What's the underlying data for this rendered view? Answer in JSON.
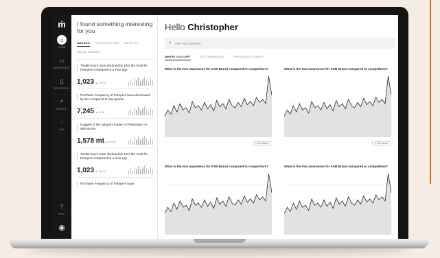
{
  "colors": {
    "accent": "#d9691f",
    "sidebar": "#161616",
    "chart_fill": "#e2e2e2",
    "chart_line": "#2a2a2a"
  },
  "sidebar": {
    "logo": "ṁ",
    "items": [
      {
        "icon": "home-icon",
        "glyph": "⌂",
        "label": "HOME",
        "active": true
      },
      {
        "icon": "folder-icon",
        "glyph": "▭",
        "label": "WORKSPACE",
        "active": false
      },
      {
        "icon": "document-icon",
        "glyph": "▯",
        "label": "RESOURCES",
        "active": false
      },
      {
        "icon": "search-icon",
        "glyph": "⌕",
        "label": "SEARCH",
        "active": false
      },
      {
        "icon": "chat-icon",
        "glyph": "◌",
        "label": "ASK",
        "active": false
      }
    ],
    "help": {
      "glyph": "?",
      "label": "HELP"
    },
    "avatar": "◉"
  },
  "nudges": {
    "title": "I found something interesting for you",
    "tabs": [
      "NUDGES",
      "NOTIFICATIONS",
      "ACTIVITY"
    ],
    "see_all": "SEE ALL NUDGES",
    "cards": [
      {
        "text": "Trialist hours have declined by 15% the most for Pampers compared to a Year ago.",
        "value": "1,023",
        "delta": "▲ 15.0%"
      },
      {
        "text": "Purchase Frequency of Pampers have decreased by 5% compared to last quarter",
        "value": "7,245",
        "delta": "▼ 5.0%"
      },
      {
        "text": "Huggies is the category leader of Penetration % with 62.9%",
        "value": "1,578 mt",
        "delta": "▲ 62.9%"
      },
      {
        "text": "Trialist hours have declined by 15% the most for Pampers compared to a Year ago.",
        "value": "1,023",
        "delta": "▲ 15.0%"
      },
      {
        "text": "Purchase Frequency of Pampers have",
        "value": "",
        "delta": ""
      }
    ]
  },
  "main": {
    "greeting": "Hello",
    "name": "Christopher",
    "search_placeholder": "Ask Your Question",
    "tabs": [
      "WHERE YOU LEFT",
      "RECOMMENDED",
      "FREQUENTLY ASKED"
    ],
    "card_title": "What is the tom awareness for XAB Brand compared to competitors?",
    "card_footer": "1,234 views",
    "chart_data": {
      "type": "area",
      "values": [
        20,
        26,
        22,
        30,
        24,
        32,
        26,
        28,
        23,
        34,
        28,
        30,
        26,
        33,
        27,
        31,
        25,
        35,
        29,
        32,
        27,
        36,
        30,
        28,
        33,
        29,
        37,
        31,
        34,
        30,
        38,
        33,
        36,
        32,
        58,
        40
      ]
    }
  }
}
